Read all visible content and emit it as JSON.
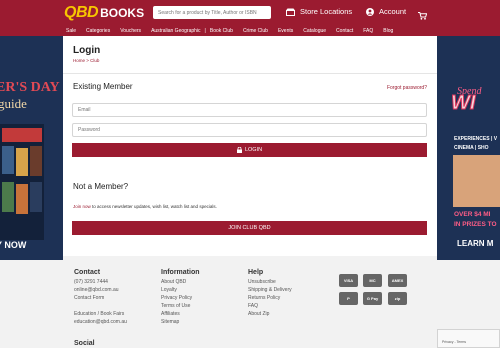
{
  "header": {
    "logo_qbd": "QBD",
    "logo_books": "BOOKS",
    "search_placeholder": "Search for a product by Title, Author or ISBN",
    "store_label": "Store Locations",
    "account_label": "Account"
  },
  "nav": {
    "items": [
      "Sale",
      "Categories",
      "Vouchers",
      "Australian Geographic",
      "Book Club",
      "Crime Club",
      "Events",
      "Catalogue",
      "Contact",
      "FAQ",
      "Blog"
    ]
  },
  "left_banner": {
    "title": "ER'S DAY",
    "subtitle": "guide",
    "cta": "Y NOW"
  },
  "right_banner": {
    "spend": "Spend",
    "headline": "WI",
    "line1": "EXPERIENCES | V",
    "line2": "CINEMA | SHO",
    "over1": "OVER $4 MI",
    "over2": "IN PRIZES TO",
    "cta": "LEARN M"
  },
  "page": {
    "title": "Login",
    "breadcrumb": "Home > Club"
  },
  "login": {
    "section_title": "Existing Member",
    "forgot": "Forgot password?",
    "email_placeholder": "Email",
    "password_placeholder": "Password",
    "button": "LOGIN"
  },
  "join": {
    "section_title": "Not a Member?",
    "link": "Join now",
    "text": " to access newsletter updates, wish list, watch list and specials.",
    "button": "JOIN CLUB QBD"
  },
  "footer": {
    "contact": {
      "heading": "Contact",
      "items": [
        "(07) 3291 7444",
        "online@qbd.com.au",
        "Contact Form",
        "",
        "Education / Book Fairs",
        "education@qbd.com.au"
      ]
    },
    "information": {
      "heading": "Information",
      "items": [
        "About QBD",
        "Loyalty",
        "Privacy Policy",
        "Terms of Use",
        "Affiliates",
        "Sitemap"
      ]
    },
    "help": {
      "heading": "Help",
      "items": [
        "Unsubscribe",
        "Shipping & Delivery",
        "Returns Policy",
        "FAQ",
        "About Zip"
      ]
    },
    "social_heading": "Social",
    "payments": [
      "VISA",
      "MC",
      "AMEX",
      "P",
      "G Pay",
      "zip",
      "AP"
    ]
  },
  "recaptcha": {
    "text": "Privacy - Terms"
  },
  "colors": {
    "brand": "#9b1b30",
    "logo_yellow": "#f7c600",
    "banner_navy": "#1d3155"
  }
}
